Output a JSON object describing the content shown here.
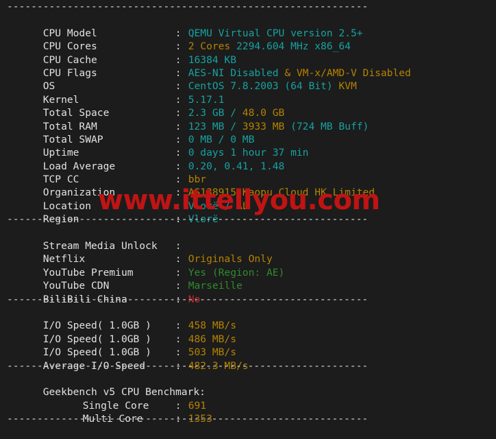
{
  "terminal": {
    "background_color": "#1c1c1c",
    "label_color": "#e2e2e2",
    "cyan_color": "#17a2a2",
    "yellow_color": "#b48300",
    "green_color": "#2e8b2e",
    "red_color": "#c42b2b",
    "separator": "------------------------------------------------------------",
    "colon": ":"
  },
  "watermark": {
    "text": "www.ittellyou.com",
    "color": "#c01414"
  },
  "system_info": [
    {
      "label": "CPU Model",
      "value": "QEMU Virtual CPU version 2.5+",
      "segments": [
        {
          "t": "QEMU Virtual CPU version 2.5+",
          "c": "cyan"
        }
      ]
    },
    {
      "label": "CPU Cores",
      "value": "2 Cores 2294.604 MHz x86_64",
      "segments": [
        {
          "t": "2 Cores ",
          "c": "yellow"
        },
        {
          "t": "2294.604 MHz x86_64",
          "c": "cyan"
        }
      ]
    },
    {
      "label": "CPU Cache",
      "value": "16384 KB",
      "segments": [
        {
          "t": "16384 KB",
          "c": "cyan"
        }
      ]
    },
    {
      "label": "CPU Flags",
      "value": "AES-NI Disabled & VM-x/AMD-V Disabled",
      "segments": [
        {
          "t": "AES-NI Disabled ",
          "c": "cyan"
        },
        {
          "t": "& VM-x/AMD-V Disabled",
          "c": "yellow"
        }
      ]
    },
    {
      "label": "OS",
      "value": "CentOS 7.8.2003 (64 Bit) KVM",
      "segments": [
        {
          "t": "CentOS 7.8.2003 (64 Bit) ",
          "c": "cyan"
        },
        {
          "t": "KVM",
          "c": "yellow"
        }
      ]
    },
    {
      "label": "Kernel",
      "value": "5.17.1",
      "segments": [
        {
          "t": "5.17.1",
          "c": "cyan"
        }
      ]
    },
    {
      "label": "Total Space",
      "value": "2.3 GB / 48.0 GB",
      "segments": [
        {
          "t": "2.3 GB / ",
          "c": "cyan"
        },
        {
          "t": "48.0 GB",
          "c": "yellow"
        }
      ]
    },
    {
      "label": "Total RAM",
      "value": "123 MB / 3933 MB (724 MB Buff)",
      "segments": [
        {
          "t": "123 MB / ",
          "c": "cyan"
        },
        {
          "t": "3933 MB ",
          "c": "yellow"
        },
        {
          "t": "(724 MB Buff)",
          "c": "cyan"
        }
      ]
    },
    {
      "label": "Total SWAP",
      "value": "0 MB / 0 MB",
      "segments": [
        {
          "t": "0 MB / 0 MB",
          "c": "cyan"
        }
      ]
    },
    {
      "label": "Uptime",
      "value": "0 days 1 hour 37 min",
      "segments": [
        {
          "t": "0 days 1 hour 37 min",
          "c": "cyan"
        }
      ]
    },
    {
      "label": "Load Average",
      "value": "0.20, 0.41, 1.48",
      "segments": [
        {
          "t": "0.20, 0.41, 1.48",
          "c": "cyan"
        }
      ]
    },
    {
      "label": "TCP CC",
      "value": "bbr",
      "segments": [
        {
          "t": "bbr",
          "c": "yellow"
        }
      ]
    },
    {
      "label": "Organization",
      "value": "AS138915 Kaopu Cloud HK Limited",
      "segments": [
        {
          "t": "AS138915 Kaopu Cloud HK Limited",
          "c": "yellow"
        }
      ]
    },
    {
      "label": "Location",
      "value": "Vlorë / AL",
      "segments": [
        {
          "t": "Vlorë / ",
          "c": "cyan"
        },
        {
          "t": "AL",
          "c": "yellow"
        }
      ]
    },
    {
      "label": "Region",
      "value": "Vlorë",
      "segments": [
        {
          "t": "Vlorë",
          "c": "cyan"
        }
      ]
    }
  ],
  "stream_media": [
    {
      "label": "Stream Media Unlock",
      "value": "",
      "segments": []
    },
    {
      "label": "Netflix",
      "value": "Originals Only",
      "segments": [
        {
          "t": "Originals Only",
          "c": "yellow"
        }
      ]
    },
    {
      "label": "YouTube Premium",
      "value": "Yes (Region: AE)",
      "segments": [
        {
          "t": "Yes (Region: AE)",
          "c": "green"
        }
      ]
    },
    {
      "label": "YouTube CDN",
      "value": "Marseille",
      "segments": [
        {
          "t": "Marseille",
          "c": "green"
        }
      ]
    },
    {
      "label": "BiliBili China",
      "value": "No",
      "segments": [
        {
          "t": "No",
          "c": "red"
        }
      ]
    }
  ],
  "io_speed": [
    {
      "label": "I/O Speed( 1.0GB )",
      "value": "458 MB/s",
      "segments": [
        {
          "t": "458 MB/s",
          "c": "yellow"
        }
      ]
    },
    {
      "label": "I/O Speed( 1.0GB )",
      "value": "486 MB/s",
      "segments": [
        {
          "t": "486 MB/s",
          "c": "yellow"
        }
      ]
    },
    {
      "label": "I/O Speed( 1.0GB )",
      "value": "503 MB/s",
      "segments": [
        {
          "t": "503 MB/s",
          "c": "yellow"
        }
      ]
    },
    {
      "label": "Average I/O Speed",
      "value": "482.3 MB/s",
      "segments": [
        {
          "t": "482.3 MB/s",
          "c": "yellow"
        }
      ]
    }
  ],
  "geekbench": {
    "heading": "Geekbench v5 CPU Benchmark:",
    "rows": [
      {
        "label": "Single Core",
        "value": "691",
        "segments": [
          {
            "t": "691",
            "c": "yellow"
          }
        ]
      },
      {
        "label": "Multi Core",
        "value": "1353",
        "segments": [
          {
            "t": "1353",
            "c": "yellow"
          }
        ]
      }
    ]
  }
}
